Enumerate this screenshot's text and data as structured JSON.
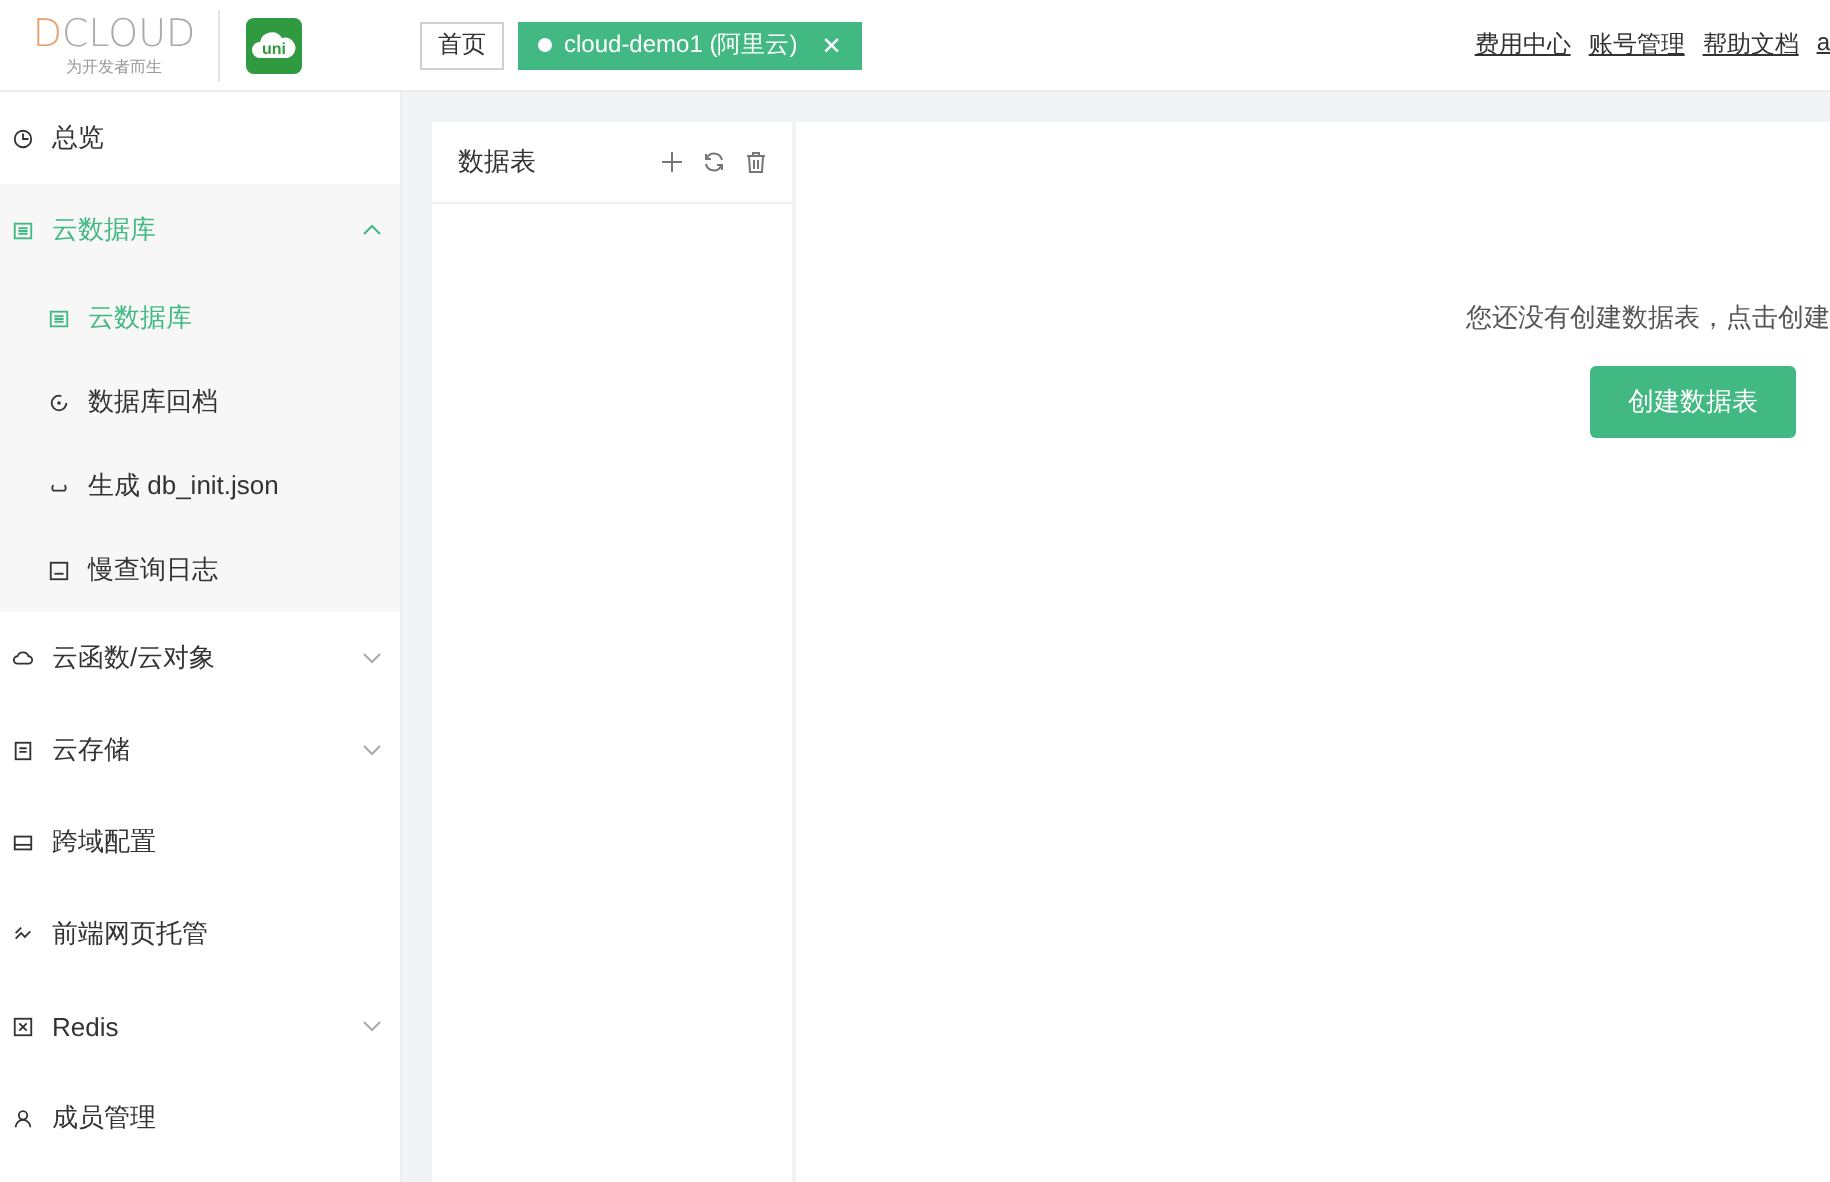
{
  "header": {
    "logo": {
      "wordmark": "DCLOUD",
      "tagline": "为开发者而生"
    },
    "app_logo": {
      "text": "uni"
    },
    "tabs": [
      {
        "label": "首页",
        "selected": false
      },
      {
        "label": "cloud-demo1 (阿里云)",
        "selected": true,
        "close": "✕"
      }
    ],
    "links": [
      "费用中心",
      "账号管理",
      "帮助文档",
      "a"
    ]
  },
  "sidebar": {
    "items": [
      {
        "label": "总览",
        "selected": false
      },
      {
        "label": "云数据库",
        "selected": true,
        "expanded": true,
        "children": [
          {
            "label": "云数据库",
            "selected": true
          },
          {
            "label": "数据库回档",
            "selected": false
          },
          {
            "label": "生成 db_init.json",
            "selected": false
          },
          {
            "label": "慢查询日志",
            "selected": false
          }
        ]
      },
      {
        "label": "云函数/云对象",
        "selected": false,
        "expanded": false
      },
      {
        "label": "云存储",
        "selected": false,
        "expanded": false
      },
      {
        "label": "跨域配置",
        "selected": false
      },
      {
        "label": "前端网页托管",
        "selected": false
      },
      {
        "label": "Redis",
        "selected": false,
        "expanded": false
      },
      {
        "label": "成员管理",
        "selected": false
      }
    ]
  },
  "table_panel": {
    "title": "数据表"
  },
  "empty_state": {
    "message": "您还没有创建数据表，点击创建",
    "button": "创建数据表"
  }
}
